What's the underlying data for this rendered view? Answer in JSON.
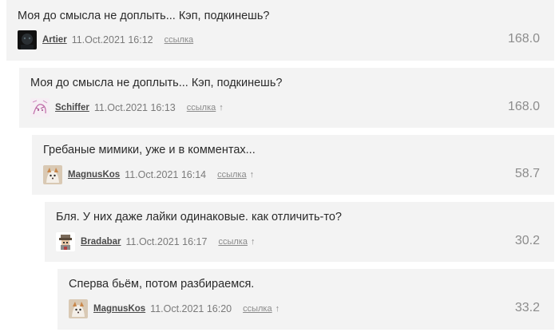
{
  "comments": [
    {
      "text": "Моя до смысла не доплыть... Кэп, подкинешь?",
      "author": "Artier",
      "date": "11.Oct.2021 16:12",
      "link_label": "ссылка",
      "arrow": "",
      "rating": "168.0",
      "avatar_icon": "dark-avatar-icon"
    },
    {
      "text": "Моя до смысла не доплыть... Кэп, подкинешь?",
      "author": "Schiffer",
      "date": "11.Oct.2021 16:13",
      "link_label": "ссылка",
      "arrow": "↑",
      "rating": "168.0",
      "avatar_icon": "sketch-avatar-icon"
    },
    {
      "text": "Гребаные мимики, уже и в комментах...",
      "author": "MagnusKos",
      "date": "11.Oct.2021 16:14",
      "link_label": "ссылка",
      "arrow": "↑",
      "rating": "58.7",
      "avatar_icon": "fox-avatar-icon"
    },
    {
      "text": "Бля. У них даже лайки одинаковые. как отличить-то?",
      "author": "Bradabar",
      "date": "11.Oct.2021 16:17",
      "link_label": "ссылка",
      "arrow": "↑",
      "rating": "30.2",
      "avatar_icon": "pixel-character-avatar-icon"
    },
    {
      "text": "Сперва бьём, потом разбираемся.",
      "author": "MagnusKos",
      "date": "11.Oct.2021 16:20",
      "link_label": "ссылка",
      "arrow": "↑",
      "rating": "33.2",
      "avatar_icon": "fox-avatar-icon"
    }
  ]
}
